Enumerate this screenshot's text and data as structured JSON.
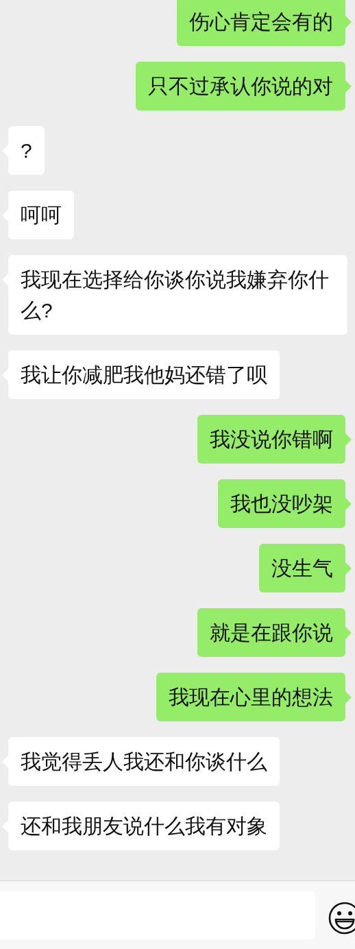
{
  "messages": [
    {
      "kind": "sent",
      "text": "伤心肯定会有的"
    },
    {
      "kind": "sent",
      "text": "只不过承认你说的对"
    },
    {
      "kind": "received",
      "text": "?"
    },
    {
      "kind": "received",
      "text": "呵呵"
    },
    {
      "kind": "received",
      "text": "我现在选择给你谈你说我嫌弃你什么?"
    },
    {
      "kind": "received",
      "text": "我让你减肥我他妈还错了呗"
    },
    {
      "kind": "sent",
      "text": "我没说你错啊"
    },
    {
      "kind": "sent",
      "text": "我也没吵架"
    },
    {
      "kind": "sent",
      "text": "没生气"
    },
    {
      "kind": "sent",
      "text": "就是在跟你说"
    },
    {
      "kind": "sent",
      "text": "我现在心里的想法"
    },
    {
      "kind": "received",
      "text": "我觉得丢人我还和你谈什么"
    },
    {
      "kind": "received",
      "text": "还和我朋友说什么我有对象"
    }
  ]
}
